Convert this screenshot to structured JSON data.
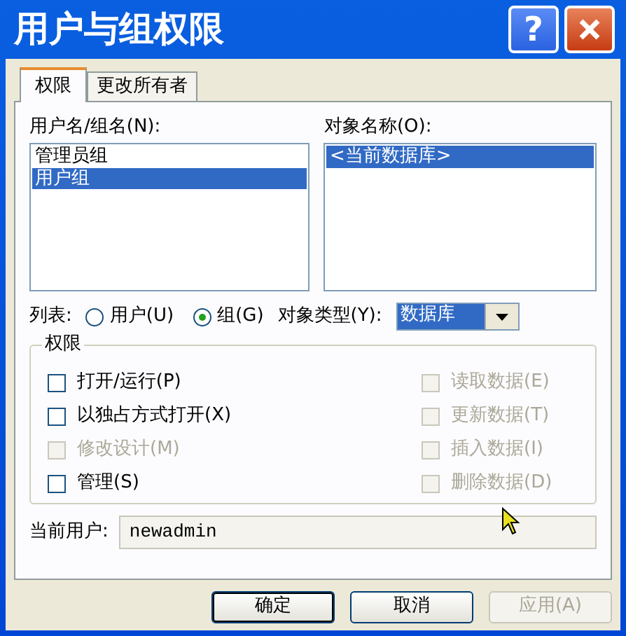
{
  "window": {
    "title": "用户与组权限",
    "help": "?"
  },
  "tabs": [
    {
      "label": "权限",
      "selected": true
    },
    {
      "label": "更改所有者",
      "selected": false
    }
  ],
  "users_list": {
    "label": "用户名/组名(N):",
    "items": [
      {
        "label": "管理员组",
        "selected": false
      },
      {
        "label": "用户组",
        "selected": true
      }
    ]
  },
  "objects_list": {
    "label": "对象名称(O):",
    "items": [
      {
        "label": "<当前数据库>",
        "selected": true
      }
    ]
  },
  "list_mode": {
    "label": "列表:",
    "options": [
      {
        "label": "用户(U)",
        "selected": false
      },
      {
        "label": "组(G)",
        "selected": true
      }
    ]
  },
  "object_type": {
    "label": "对象类型(Y):",
    "value": "数据库"
  },
  "permissions": {
    "title": "权限",
    "left": [
      {
        "label": "打开/运行(P)",
        "checked": false,
        "disabled": false
      },
      {
        "label": "以独占方式打开(X)",
        "checked": false,
        "disabled": false
      },
      {
        "label": "修改设计(M)",
        "checked": false,
        "disabled": true
      },
      {
        "label": "管理(S)",
        "checked": false,
        "disabled": false
      }
    ],
    "right": [
      {
        "label": "读取数据(E)",
        "checked": false,
        "disabled": true
      },
      {
        "label": "更新数据(T)",
        "checked": false,
        "disabled": true
      },
      {
        "label": "插入数据(I)",
        "checked": false,
        "disabled": true
      },
      {
        "label": "删除数据(D)",
        "checked": false,
        "disabled": true
      }
    ]
  },
  "current_user": {
    "label": "当前用户:",
    "value": "newadmin"
  },
  "buttons": [
    {
      "label": "确定",
      "default": true,
      "disabled": false
    },
    {
      "label": "取消",
      "default": false,
      "disabled": false
    },
    {
      "label": "应用(A)",
      "default": false,
      "disabled": true
    }
  ]
}
